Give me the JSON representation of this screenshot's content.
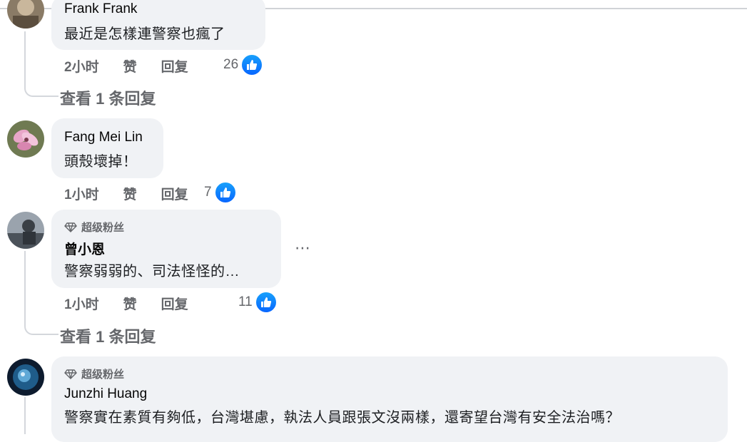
{
  "comments": [
    {
      "name": "Frank Frank",
      "text": "最近是怎樣連警察也瘋了",
      "time": "2小时",
      "like_label": "赞",
      "reply_label": "回复",
      "likes": "26",
      "view_replies": "查看 1 条回复"
    },
    {
      "name": "Fang Mei Lin",
      "text": "頭殼壞掉！",
      "time": "1小时",
      "like_label": "赞",
      "reply_label": "回复",
      "likes": "7"
    },
    {
      "badge": "超级粉丝",
      "name": "曾小恩",
      "text": "警察弱弱的、司法怪怪的…",
      "more": "⋯",
      "time": "1小时",
      "like_label": "赞",
      "reply_label": "回复",
      "likes": "11",
      "view_replies": "查看 1 条回复"
    },
    {
      "badge": "超级粉丝",
      "name": "Junzhi Huang",
      "text": "警察實在素質有夠低，台灣堪慮，執法人員跟張文沒兩樣，還寄望台灣有安全法治嗎？"
    }
  ],
  "colors": {
    "bubble": "#f0f2f5",
    "meta_text": "#65676b",
    "like_blue": "#0866ff"
  },
  "icons": {
    "like": "thumbs-up-icon",
    "badge": "diamond-icon",
    "more": "more-options-icon"
  }
}
